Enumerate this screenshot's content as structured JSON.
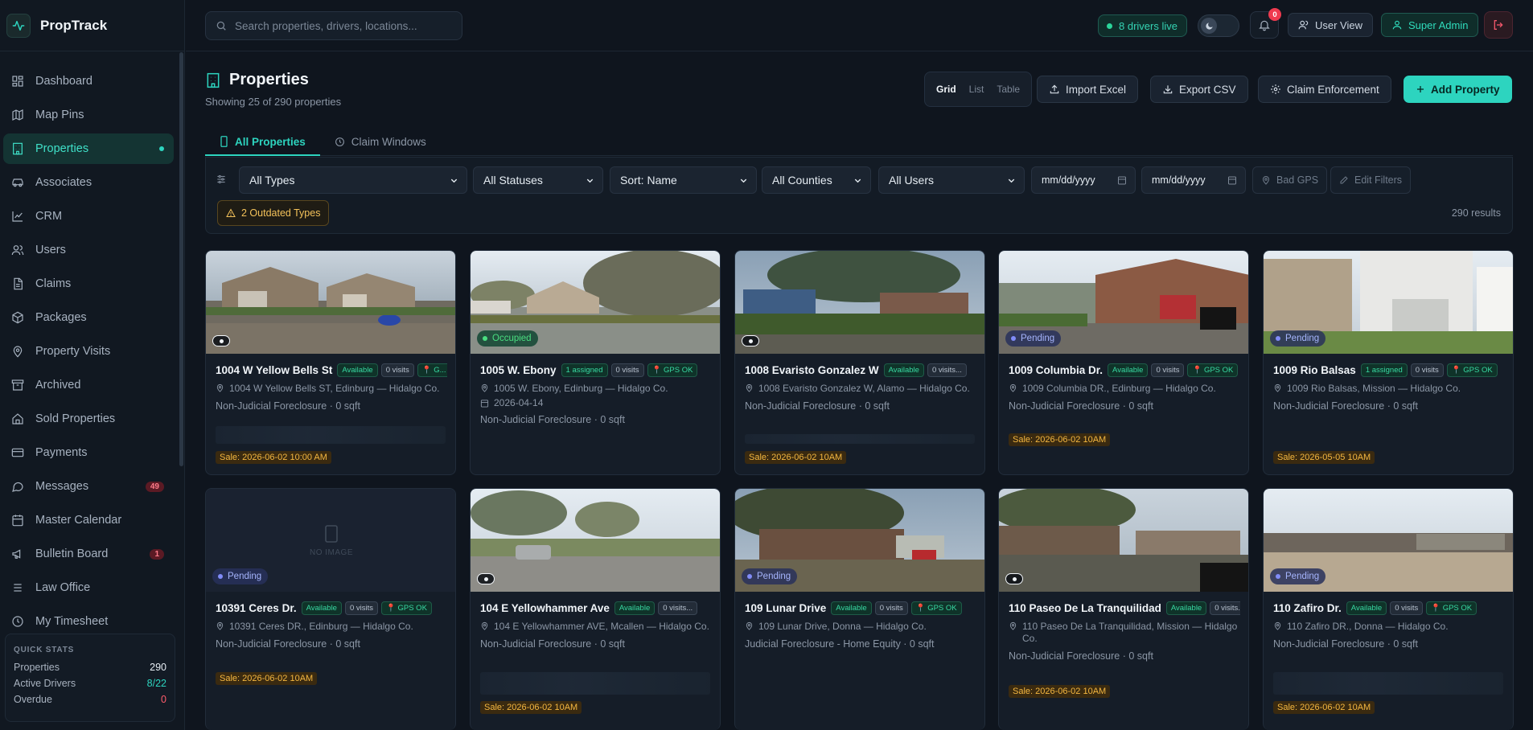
{
  "app": {
    "name": "PropTrack"
  },
  "nav": {
    "items": [
      {
        "label": "Dashboard",
        "icon": "dashboard-icon"
      },
      {
        "label": "Map Pins",
        "icon": "map-icon"
      },
      {
        "label": "Properties",
        "icon": "building-icon",
        "active": true
      },
      {
        "label": "Associates",
        "icon": "car-icon"
      },
      {
        "label": "CRM",
        "icon": "chart-icon"
      },
      {
        "label": "Users",
        "icon": "users-icon"
      },
      {
        "label": "Claims",
        "icon": "file-icon"
      },
      {
        "label": "Packages",
        "icon": "package-icon"
      },
      {
        "label": "Property Visits",
        "icon": "pin-icon"
      },
      {
        "label": "Archived",
        "icon": "archive-icon"
      },
      {
        "label": "Sold Properties",
        "icon": "home-icon"
      },
      {
        "label": "Payments",
        "icon": "card-icon"
      },
      {
        "label": "Messages",
        "icon": "message-icon",
        "badge": "49"
      },
      {
        "label": "Master Calendar",
        "icon": "calendar-icon"
      },
      {
        "label": "Bulletin Board",
        "icon": "megaphone-icon",
        "badge": "1"
      },
      {
        "label": "Law Office",
        "icon": "menu-icon"
      },
      {
        "label": "My Timesheet",
        "icon": "clock-icon"
      }
    ]
  },
  "quick_stats": {
    "title": "QUICK STATS",
    "properties_label": "Properties",
    "properties_value": "290",
    "drivers_label": "Active Drivers",
    "drivers_value": "8/22",
    "overdue_label": "Overdue",
    "overdue_value": "0"
  },
  "topbar": {
    "search_placeholder": "Search properties, drivers, locations...",
    "drivers_live": "8 drivers live",
    "notif_count": "0",
    "user_view": "User View",
    "super_admin": "Super Admin"
  },
  "page": {
    "title": "Properties",
    "subtitle": "Showing 25 of 290 properties",
    "views": [
      "Grid",
      "List",
      "Table"
    ],
    "import": "Import Excel",
    "export": "Export CSV",
    "claim": "Claim Enforcement",
    "add": "Add Property"
  },
  "tabs": {
    "all": "All Properties",
    "claim": "Claim Windows"
  },
  "filters": {
    "types": "All Types",
    "statuses": "All Statuses",
    "sort": "Sort: Name",
    "counties": "All Counties",
    "users": "All Users",
    "date_from": "mm/dd/yyyy",
    "date_to": "mm/dd/yyyy",
    "bad_gps": "Bad GPS",
    "edit": "Edit Filters",
    "outdated": "2 Outdated Types",
    "results": "290 results"
  },
  "cards": [
    {
      "title": "1004 W Yellow Bells St",
      "tags": [
        "Available",
        "0 visits",
        "📍 G..."
      ],
      "address": "1004 W Yellow Bells ST, Edinburg — Hidalgo Co.",
      "type": "Non-Judicial Foreclosure · 0 sqft",
      "sale": "Sale: 2026-06-02 10:00 AM",
      "status": "",
      "eye": true
    },
    {
      "title": "1005 W. Ebony",
      "tags": [
        "1 assigned",
        "0 visits",
        "📍 GPS OK"
      ],
      "address": "1005 W. Ebony, Edinburg — Hidalgo Co.",
      "date": "2026-04-14",
      "type": "Non-Judicial Foreclosure · 0 sqft",
      "sale": "",
      "status": "Occupied"
    },
    {
      "title": "1008 Evaristo Gonzalez W",
      "tags": [
        "Available",
        "0 visits..."
      ],
      "address": "1008 Evaristo Gonzalez W, Alamo — Hidalgo Co.",
      "type": "Non-Judicial Foreclosure · 0 sqft",
      "sale": "Sale: 2026-06-02 10AM",
      "status": "",
      "eye": true
    },
    {
      "title": "1009 Columbia Dr.",
      "tags": [
        "Available",
        "0 visits",
        "📍 GPS OK"
      ],
      "address": "1009 Columbia DR., Edinburg — Hidalgo Co.",
      "type": "Non-Judicial Foreclosure · 0 sqft",
      "sale": "Sale: 2026-06-02 10AM",
      "status": "Pending"
    },
    {
      "title": "1009 Rio Balsas",
      "tags": [
        "1 assigned",
        "0 visits",
        "📍 GPS OK"
      ],
      "address": "1009 Rio Balsas, Mission — Hidalgo Co.",
      "type": "Non-Judicial Foreclosure · 0 sqft",
      "sale": "Sale: 2026-05-05 10AM",
      "status": "Pending"
    },
    {
      "title": "10391 Ceres Dr.",
      "tags": [
        "Available",
        "0 visits",
        "📍 GPS OK"
      ],
      "address": "10391 Ceres DR., Edinburg — Hidalgo Co.",
      "type": "Non-Judicial Foreclosure · 0 sqft",
      "sale": "Sale: 2026-06-02 10AM",
      "status": "Pending",
      "noimage": "NO IMAGE"
    },
    {
      "title": "104 E Yellowhammer Ave",
      "tags": [
        "Available",
        "0 visits..."
      ],
      "address": "104 E Yellowhammer AVE, Mcallen — Hidalgo Co.",
      "type": "Non-Judicial Foreclosure · 0 sqft",
      "sale": "Sale: 2026-06-02 10AM",
      "status": "",
      "eye": true
    },
    {
      "title": "109 Lunar Drive",
      "tags": [
        "Available",
        "0 visits",
        "📍 GPS OK"
      ],
      "address": "109 Lunar Drive, Donna — Hidalgo Co.",
      "type": "Judicial Foreclosure - Home Equity · 0 sqft",
      "sale": "",
      "status": "Pending"
    },
    {
      "title": "110 Paseo De La Tranquilidad",
      "tags": [
        "Available",
        "0 visits..."
      ],
      "address": "110 Paseo De La Tranquilidad, Mission — Hidalgo Co.",
      "type": "Non-Judicial Foreclosure · 0 sqft",
      "sale": "Sale: 2026-06-02 10AM",
      "status": "",
      "eye": true
    },
    {
      "title": "110 Zafiro Dr.",
      "tags": [
        "Available",
        "0 visits",
        "📍 GPS OK"
      ],
      "address": "110 Zafiro DR., Donna — Hidalgo Co.",
      "type": "Non-Judicial Foreclosure · 0 sqft",
      "sale": "Sale: 2026-06-02 10AM",
      "status": "Pending"
    }
  ],
  "colors": {
    "accent": "#2dd4bf",
    "bg": "#0f151e",
    "sale": "#f4b740",
    "pending": "#818cf8",
    "occupied": "#4ade80"
  }
}
